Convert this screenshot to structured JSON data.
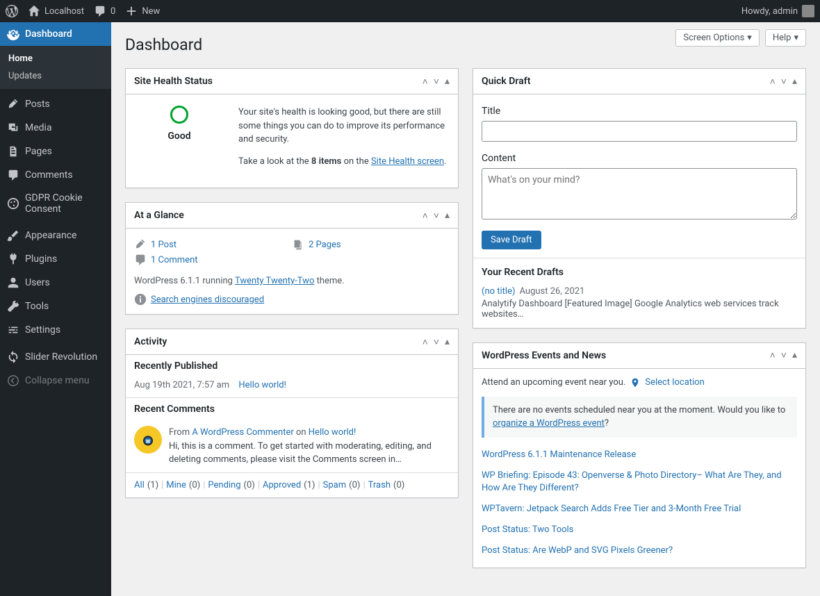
{
  "adminbar": {
    "site_name": "Localhost",
    "comment_count": "0",
    "new_label": "New",
    "howdy": "Howdy, admin"
  },
  "sidebar": {
    "dashboard": "Dashboard",
    "home": "Home",
    "updates": "Updates",
    "posts": "Posts",
    "media": "Media",
    "pages": "Pages",
    "comments": "Comments",
    "gdpr": "GDPR Cookie Consent",
    "appearance": "Appearance",
    "plugins": "Plugins",
    "users": "Users",
    "tools": "Tools",
    "settings": "Settings",
    "slider": "Slider Revolution",
    "collapse": "Collapse menu"
  },
  "header": {
    "title": "Dashboard",
    "screen_options": "Screen Options",
    "help": "Help"
  },
  "site_health": {
    "heading": "Site Health Status",
    "status_label": "Good",
    "text1": "Your site's health is looking good, but there are still some things you can do to improve its performance and security.",
    "text2_a": "Take a look at the ",
    "text2_b": "8 items",
    "text2_c": " on the ",
    "text2_link": "Site Health screen",
    "text2_d": "."
  },
  "glance": {
    "heading": "At a Glance",
    "posts": "1 Post",
    "pages": "2 Pages",
    "comments": "1 Comment",
    "version_a": "WordPress 6.1.1 running ",
    "version_link": "Twenty Twenty-Two",
    "version_b": " theme.",
    "search_engines": "Search engines discouraged"
  },
  "activity": {
    "heading": "Activity",
    "recently_published": "Recently Published",
    "pub_date": "Aug 19th 2021, 7:57 am",
    "pub_title": "Hello world!",
    "recent_comments": "Recent Comments",
    "comment_from": "From ",
    "comment_author": "A WordPress Commenter",
    "comment_on": " on ",
    "comment_post": "Hello world!",
    "comment_text": "Hi, this is a comment. To get started with moderating, editing, and deleting comments, please visit the Comments screen in…",
    "filters": {
      "all": "All",
      "all_c": "(1)",
      "mine": "Mine",
      "mine_c": "(0)",
      "pending": "Pending",
      "pending_c": "(0)",
      "approved": "Approved",
      "approved_c": "(1)",
      "spam": "Spam",
      "spam_c": "(0)",
      "trash": "Trash",
      "trash_c": "(0)"
    }
  },
  "quick_draft": {
    "heading": "Quick Draft",
    "title_label": "Title",
    "content_label": "Content",
    "content_placeholder": "What's on your mind?",
    "save": "Save Draft",
    "recent_heading": "Your Recent Drafts",
    "draft_title": "(no title)",
    "draft_date": "August 26, 2021",
    "draft_excerpt": "Analytify Dashboard [Featured Image] Google Analytics web services track websites…"
  },
  "events": {
    "heading": "WordPress Events and News",
    "attend": "Attend an upcoming event near you.",
    "select_location": "Select location",
    "notice_a": "There are no events scheduled near you at the moment. Would you like to ",
    "notice_link": "organize a WordPress event",
    "notice_b": "?",
    "news": [
      "WordPress 6.1.1 Maintenance Release",
      "WP Briefing: Episode 43: Openverse & Photo Directory– What Are They, and How Are They Different?",
      "WPTavern: Jetpack Search Adds Free Tier and 3-Month Free Trial",
      "Post Status: Two Tools",
      "Post Status: Are WebP and SVG Pixels Greener?"
    ]
  }
}
